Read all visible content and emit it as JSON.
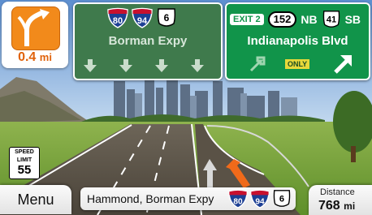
{
  "maneuver": {
    "distance_value": "0.4",
    "distance_unit": "mi",
    "icon": "keep-right-fork-icon"
  },
  "sign_left": {
    "shields": [
      {
        "type": "interstate",
        "number": "80"
      },
      {
        "type": "interstate",
        "number": "94"
      },
      {
        "type": "us-route",
        "number": "6"
      }
    ],
    "destination": "Borman Expy"
  },
  "sign_right": {
    "exit_label": "EXIT 2",
    "route_oval": "152",
    "direction_1": "NB",
    "route_shield": "41",
    "direction_2": "SB",
    "destination": "Indianapolis Blvd",
    "lane_note": "ONLY"
  },
  "speed_limit": {
    "line1": "SPEED",
    "line2": "LIMIT",
    "value": "55"
  },
  "bottom": {
    "menu_label": "Menu",
    "street": "Hammond, Borman Expy",
    "street_shields": [
      {
        "type": "interstate",
        "number": "80"
      },
      {
        "type": "interstate",
        "number": "94"
      },
      {
        "type": "us-route",
        "number": "6"
      }
    ],
    "distance_label": "Distance",
    "distance_value": "768",
    "distance_unit": "mi"
  },
  "colors": {
    "sign_green_dark": "#3f7a4c",
    "sign_green": "#11944a",
    "accent_orange": "#f28a1b",
    "interstate_blue": "#1c3f94",
    "interstate_red": "#c8102e"
  }
}
